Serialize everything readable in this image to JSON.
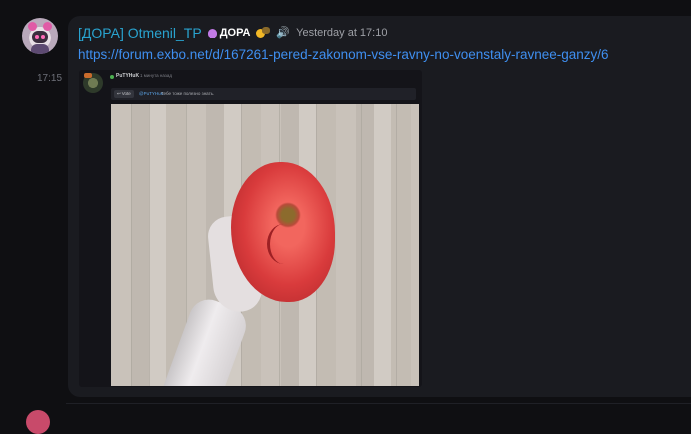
{
  "message": {
    "username": "[ДОРА] Otmenil_TP",
    "role_tag": "ДОРА",
    "timestamp": "Yesterday at 17:10",
    "side_time": "17:15",
    "link": "https://forum.exbo.net/d/167261-pered-zakonom-vse-ravny-no-voenstaly-ravnee-ganzy/6",
    "icons": {
      "role": "mushroom-icon",
      "badge": "paw-badge-icon",
      "speaker": "speaker-icon"
    }
  },
  "embed": {
    "author": "PuTYHuK",
    "ago": "1 минута назад",
    "quote_button": "Vote",
    "quote_user": "@PuTYHuK",
    "quote_text": "Тебе тоже полезно знать."
  },
  "colors": {
    "username": "#29a3cf",
    "link": "#3f8ff0",
    "background": "#0f0f12",
    "message_bg": "#1a1b20"
  }
}
